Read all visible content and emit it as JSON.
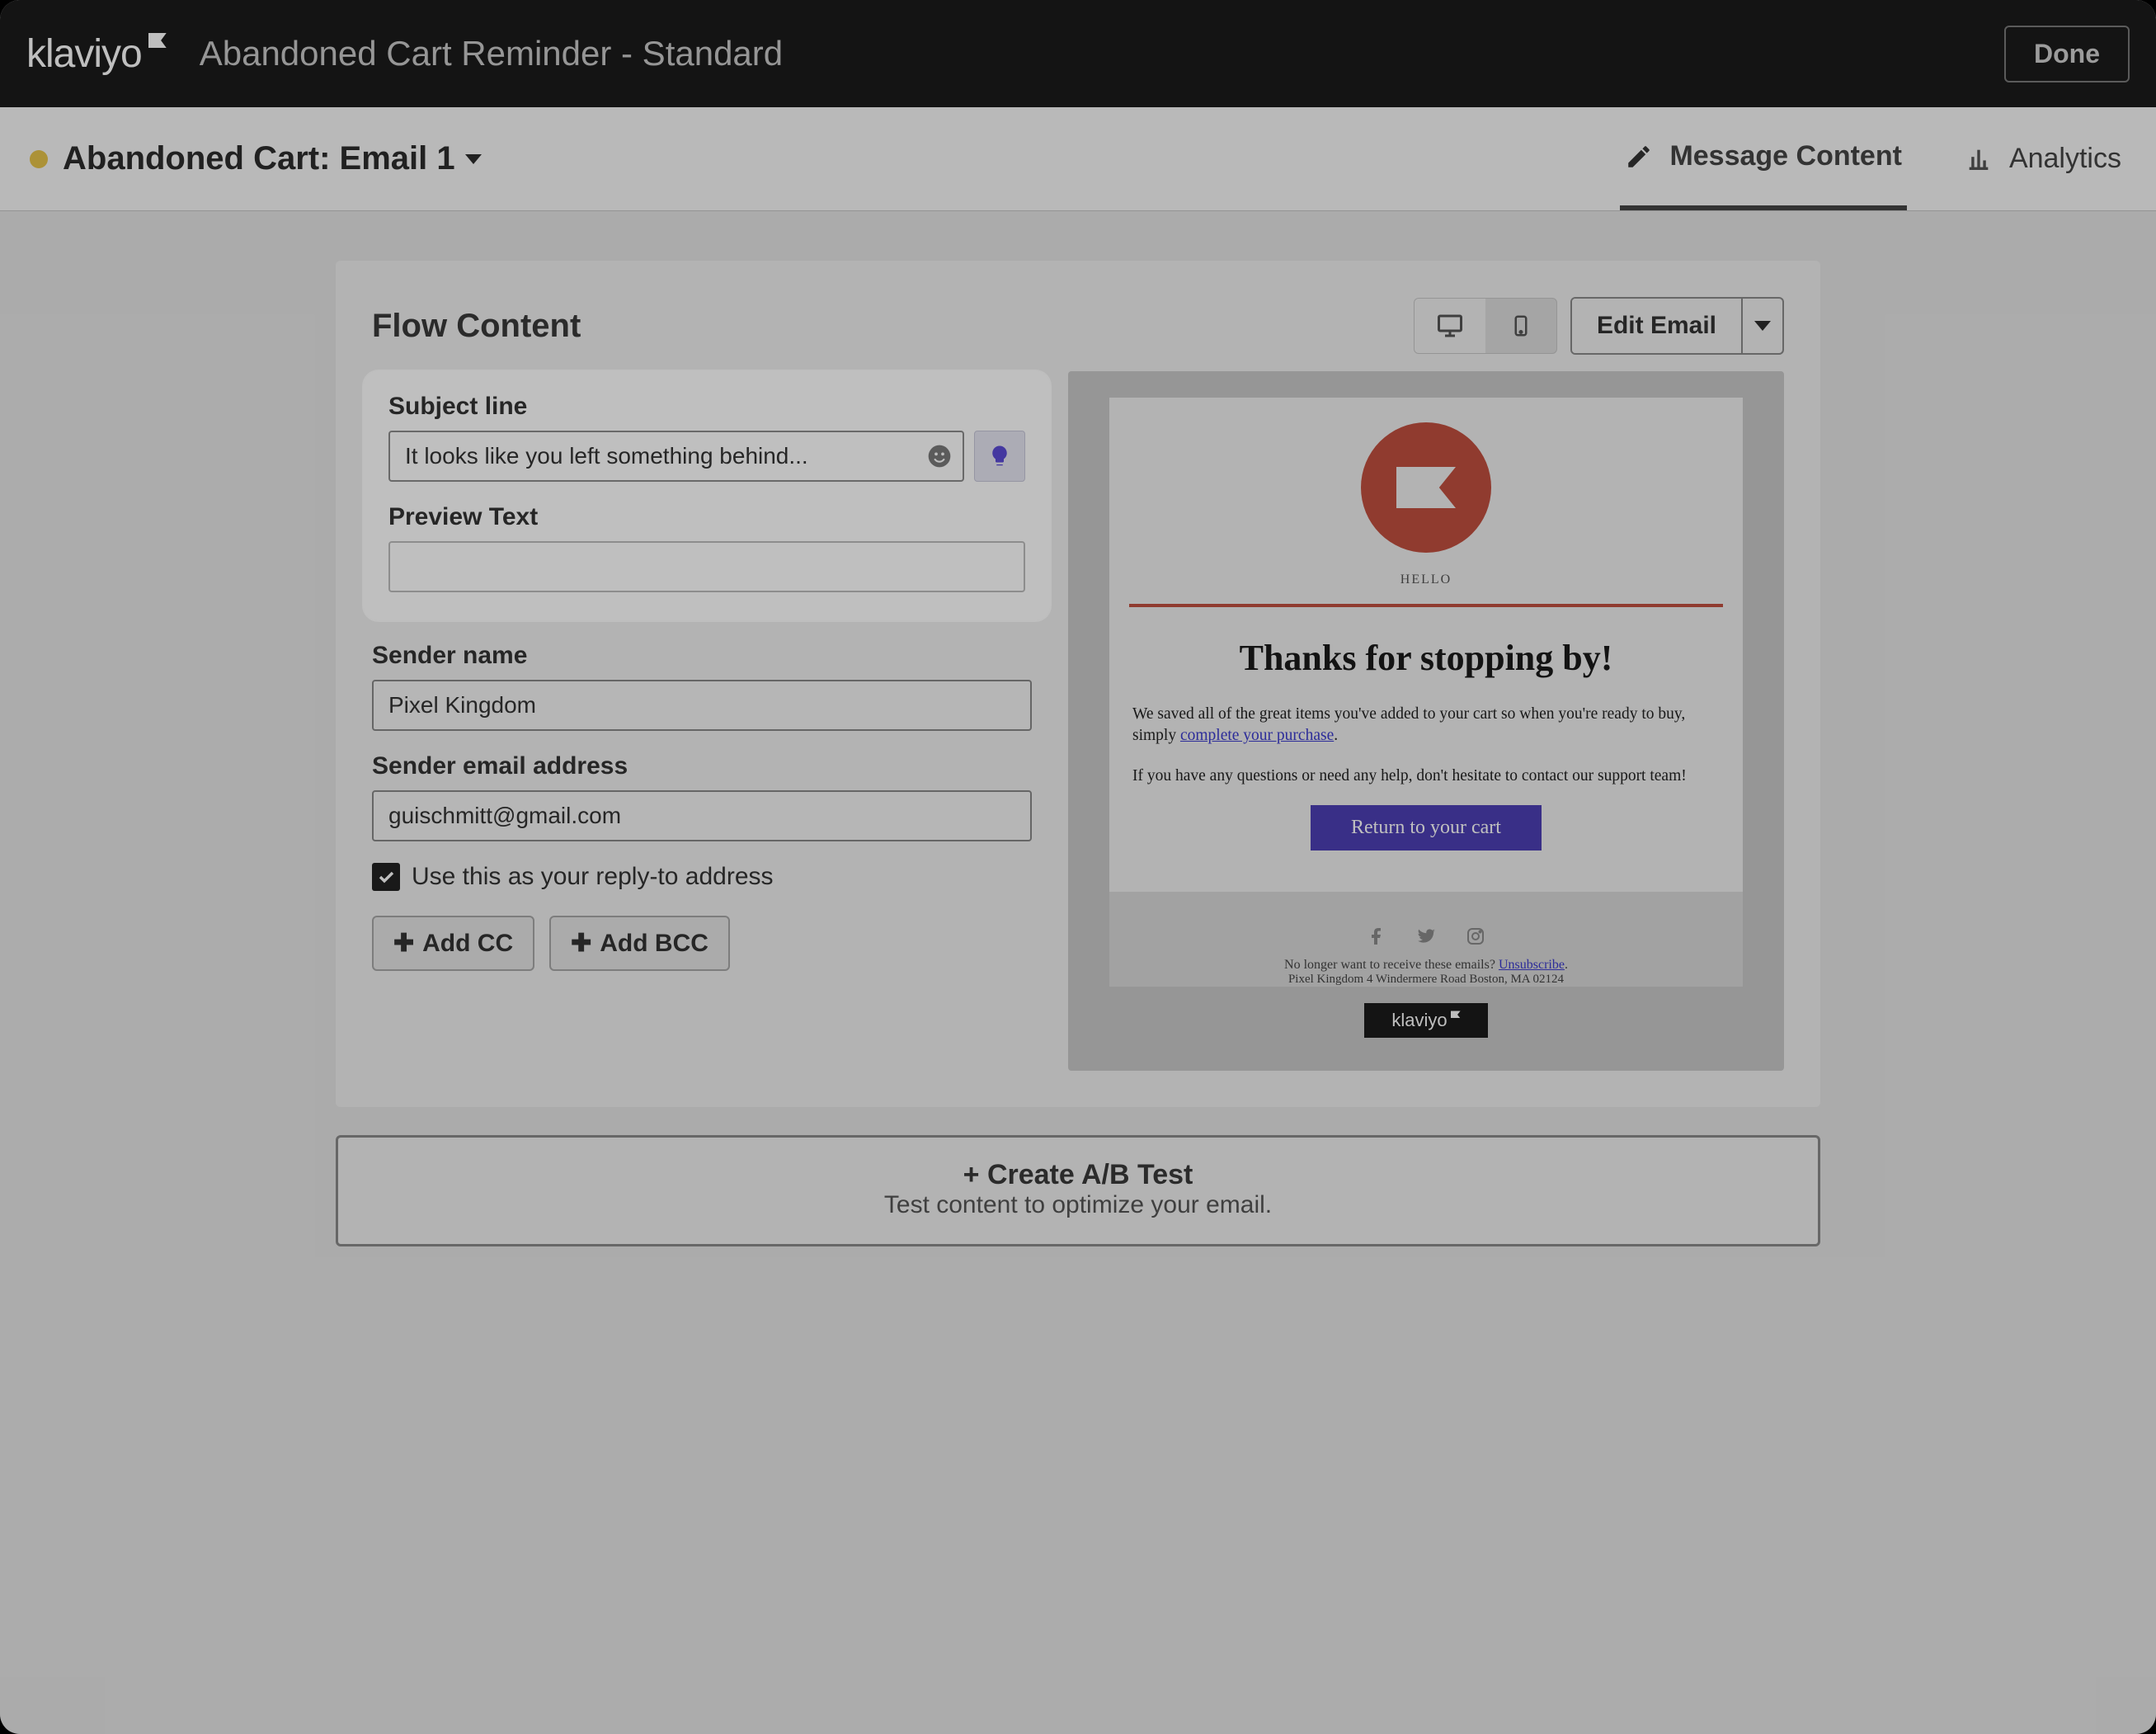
{
  "topbar": {
    "logo_text": "klaviyo",
    "breadcrumb": "Abandoned Cart Reminder - Standard",
    "done_label": "Done"
  },
  "subheader": {
    "email_title": "Abandoned Cart: Email 1",
    "tabs": {
      "message_content": "Message Content",
      "analytics": "Analytics"
    }
  },
  "card": {
    "title": "Flow Content",
    "edit_label": "Edit Email"
  },
  "form": {
    "subject_label": "Subject line",
    "subject_value": "It looks like you left something behind...",
    "preview_label": "Preview Text",
    "preview_value": "",
    "sender_name_label": "Sender name",
    "sender_name_value": "Pixel Kingdom",
    "sender_email_label": "Sender email address",
    "sender_email_value": "guischmitt@gmail.com",
    "reply_to_label": "Use this as your reply-to address",
    "add_cc_label": "Add CC",
    "add_bcc_label": "Add BCC"
  },
  "preview": {
    "hello": "HELLO",
    "heading": "Thanks for stopping by!",
    "body1_a": "We saved all of the great items you've added to your cart so when you're ready to buy, simply ",
    "body1_link": "complete your purchase",
    "body1_b": ".",
    "body2": "If you have any questions or need any help, don't hesitate to contact our support team!",
    "cta": "Return to your cart",
    "unsub_a": "No longer want to receive these emails? ",
    "unsub_link": "Unsubscribe",
    "unsub_b": ".",
    "address": "Pixel Kingdom 4 Windermere Road Boston, MA 02124",
    "badge_text": "klaviyo"
  },
  "ab": {
    "title": "+ Create A/B Test",
    "subtitle": "Test content to optimize your email."
  }
}
